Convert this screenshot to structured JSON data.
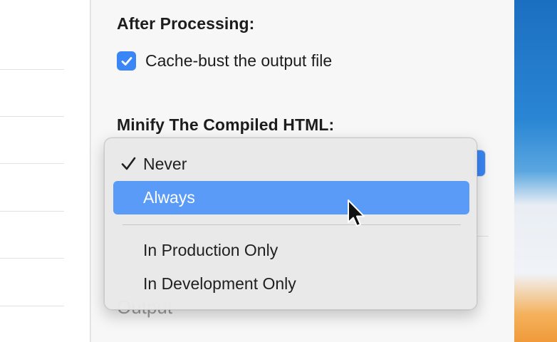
{
  "settings": {
    "after_processing_title": "After Processing:",
    "cache_bust_label": "Cache-bust the output file",
    "cache_bust_checked": true,
    "minify_title": "Minify The Compiled HTML:",
    "output_label": "Output"
  },
  "minify_menu": {
    "selected": "Never",
    "highlighted": "Always",
    "items": [
      {
        "label": "Never"
      },
      {
        "label": "Always"
      },
      {
        "label": "In Production Only"
      },
      {
        "label": "In Development Only"
      }
    ]
  },
  "colors": {
    "accent": "#3a86f6",
    "menu_highlight": "#5a9bf7"
  },
  "icons": {
    "checkbox": "checkmark-icon",
    "selected_item": "checkmark-icon",
    "pointer": "mouse-pointer-icon"
  }
}
